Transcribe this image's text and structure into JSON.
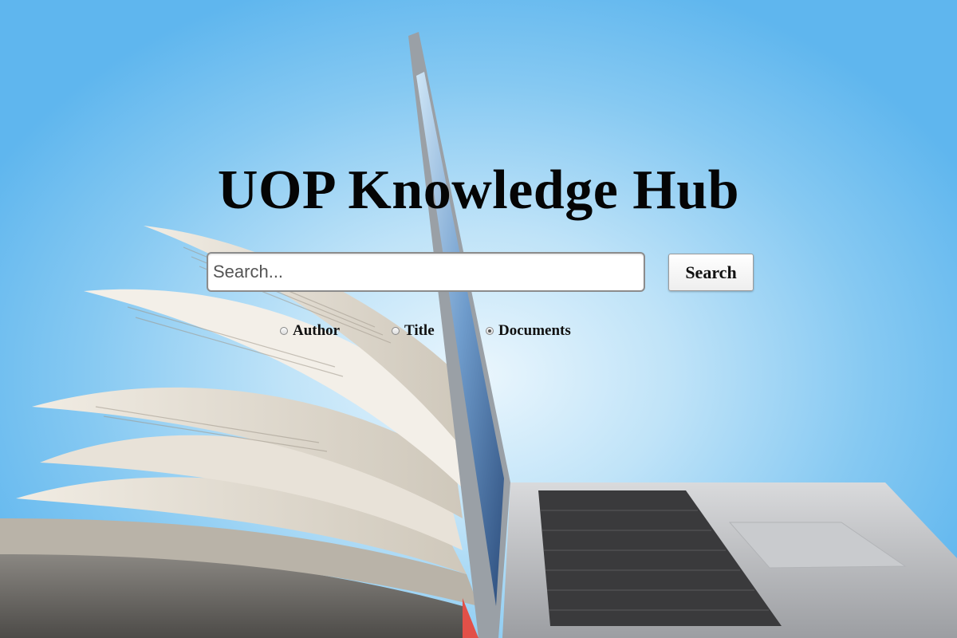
{
  "page": {
    "title": "UOP Knowledge Hub"
  },
  "search": {
    "placeholder": "Search...",
    "value": "",
    "button_label": "Search"
  },
  "filters": {
    "options": [
      {
        "label": "Author",
        "checked": false
      },
      {
        "label": "Title",
        "checked": false
      },
      {
        "label": "Documents",
        "checked": true
      }
    ]
  },
  "background": {
    "description_icon": "book-and-laptop-illustration",
    "sky_color": "#5fb6ee"
  }
}
